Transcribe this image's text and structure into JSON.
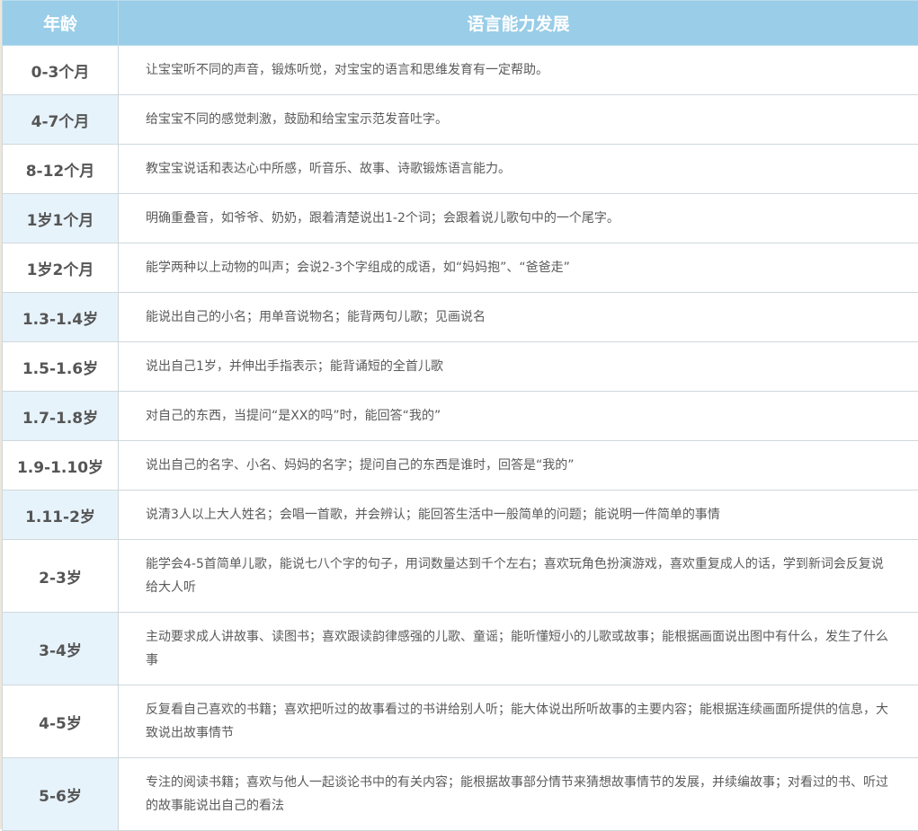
{
  "table": {
    "header": {
      "age": "年龄",
      "language": "语言能力发展"
    },
    "rows": [
      {
        "age": "0-3个月",
        "text": "让宝宝听不同的声音，锻炼听觉，对宝宝的语言和思维发育有一定帮助。"
      },
      {
        "age": "4-7个月",
        "text": "给宝宝不同的感觉刺激，鼓励和给宝宝示范发音吐字。"
      },
      {
        "age": "8-12个月",
        "text": "教宝宝说话和表达心中所感，听音乐、故事、诗歌锻炼语言能力。"
      },
      {
        "age": "1岁1个月",
        "text": "明确重叠音，如爷爷、奶奶，跟着清楚说出1-2个词；会跟着说儿歌句中的一个尾字。"
      },
      {
        "age": "1岁2个月",
        "text": "能学两种以上动物的叫声；会说2-3个字组成的成语，如“妈妈抱”、“爸爸走”"
      },
      {
        "age": "1.3-1.4岁",
        "text": "能说出自己的小名；用单音说物名；能背两句儿歌；见画说名"
      },
      {
        "age": "1.5-1.6岁",
        "text": "说出自己1岁，并伸出手指表示；能背诵短的全首儿歌"
      },
      {
        "age": "1.7-1.8岁",
        "text": "对自己的东西，当提问“是XX的吗”时，能回答“我的”"
      },
      {
        "age": "1.9-1.10岁",
        "text": "说出自己的名字、小名、妈妈的名字；提问自己的东西是谁时，回答是“我的”"
      },
      {
        "age": "1.11-2岁",
        "text": "说清3人以上大人姓名；会唱一首歌，并会辨认；能回答生活中一般简单的问题；能说明一件简单的事情"
      },
      {
        "age": "2-3岁",
        "text": "能学会4-5首简单儿歌，能说七八个字的句子，用词数量达到千个左右；喜欢玩角色扮演游戏，喜欢重复成人的话，学到新词会反复说给大人听"
      },
      {
        "age": "3-4岁",
        "text": "主动要求成人讲故事、读图书；喜欢跟读韵律感强的儿歌、童谣；能听懂短小的儿歌或故事；能根据画面说出图中有什么，发生了什么事"
      },
      {
        "age": "4-5岁",
        "text": "反复看自己喜欢的书籍；喜欢把听过的故事看过的书讲给别人听；能大体说出所听故事的主要内容；能根据连续画面所提供的信息，大致说出故事情节"
      },
      {
        "age": "5-6岁",
        "text": "专注的阅读书籍；喜欢与他人一起谈论书中的有关内容；能根据故事部分情节来猜想故事情节的发展，并续编故事；对看过的书、听过的故事能说出自己的看法"
      }
    ]
  }
}
